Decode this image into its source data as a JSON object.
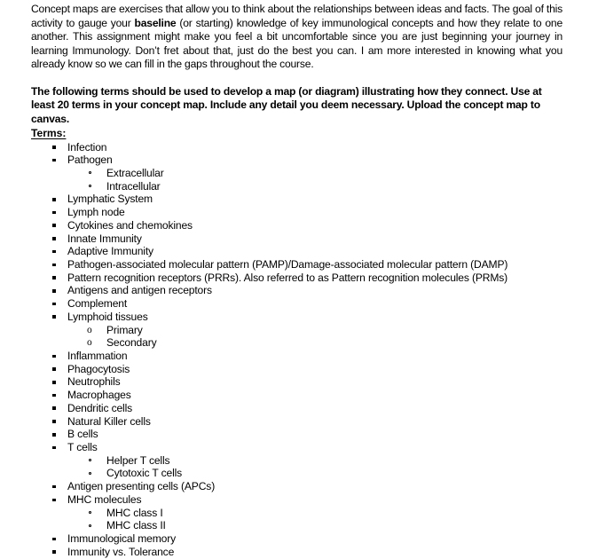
{
  "document": {
    "intro_paragraph": {
      "before_bold": "Concept maps are exercises that allow you to think about the relationships between ideas and facts. The goal of this activity to gauge your ",
      "bold_word": "baseline",
      "after_bold": " (or starting) knowledge of key immunological concepts and how they relate to one another. This assignment might make you feel a bit uncomfortable since you are just beginning your journey in learning Immunology. Don’t fret about that, just do the best you can. I am more interested in knowing what you already know so we can fill in the gaps throughout the course."
    },
    "instructions": "The following terms should be used to develop a map (or diagram) illustrating how they connect. Use at least 20 terms in your concept map. Include any detail you deem necessary. Upload the concept map to canvas.",
    "terms_heading": "Terms:",
    "terms": [
      {
        "label": "Infection"
      },
      {
        "label": "Pathogen",
        "children": [
          {
            "label": "Extracellular",
            "bullet": "ring"
          },
          {
            "label": "Intracellular",
            "bullet": "ring"
          }
        ]
      },
      {
        "label": "Lymphatic System"
      },
      {
        "label": "Lymph node"
      },
      {
        "label": "Cytokines and chemokines"
      },
      {
        "label": "Innate Immunity"
      },
      {
        "label": "Adaptive Immunity"
      },
      {
        "label": "Pathogen-associated molecular pattern (PAMP)/Damage-associated molecular pattern (DAMP)"
      },
      {
        "label": "Pattern recognition receptors (PRRs). Also referred to as Pattern recognition molecules (PRMs)"
      },
      {
        "label": "Antigens and antigen receptors"
      },
      {
        "label": "Complement"
      },
      {
        "label": "Lymphoid tissues",
        "children": [
          {
            "label": "Primary",
            "bullet": "o"
          },
          {
            "label": "Secondary",
            "bullet": "o"
          }
        ]
      },
      {
        "label": "Inflammation"
      },
      {
        "label": "Phagocytosis"
      },
      {
        "label": "Neutrophils"
      },
      {
        "label": "Macrophages"
      },
      {
        "label": "Dendritic cells"
      },
      {
        "label": "Natural Killer cells"
      },
      {
        "label": "B cells"
      },
      {
        "label": "T cells",
        "children": [
          {
            "label": "Helper T cells",
            "bullet": "ring"
          },
          {
            "label": "Cytotoxic T cells",
            "bullet": "ring"
          }
        ]
      },
      {
        "label": "Antigen presenting cells (APCs)"
      },
      {
        "label": "MHC molecules",
        "children": [
          {
            "label": "MHC class I",
            "bullet": "ring"
          },
          {
            "label": "MHC class II",
            "bullet": "ring"
          }
        ]
      },
      {
        "label": "Immunological memory"
      },
      {
        "label": "Immunity vs. Tolerance"
      }
    ],
    "bullet_glyphs": {
      "level1": "filled-square-bullet",
      "level2_ring": "hollow-circle-bullet",
      "level2_o": "o-letter-bullet"
    },
    "colors": {
      "text": "#000000",
      "background": "#ffffff"
    }
  }
}
